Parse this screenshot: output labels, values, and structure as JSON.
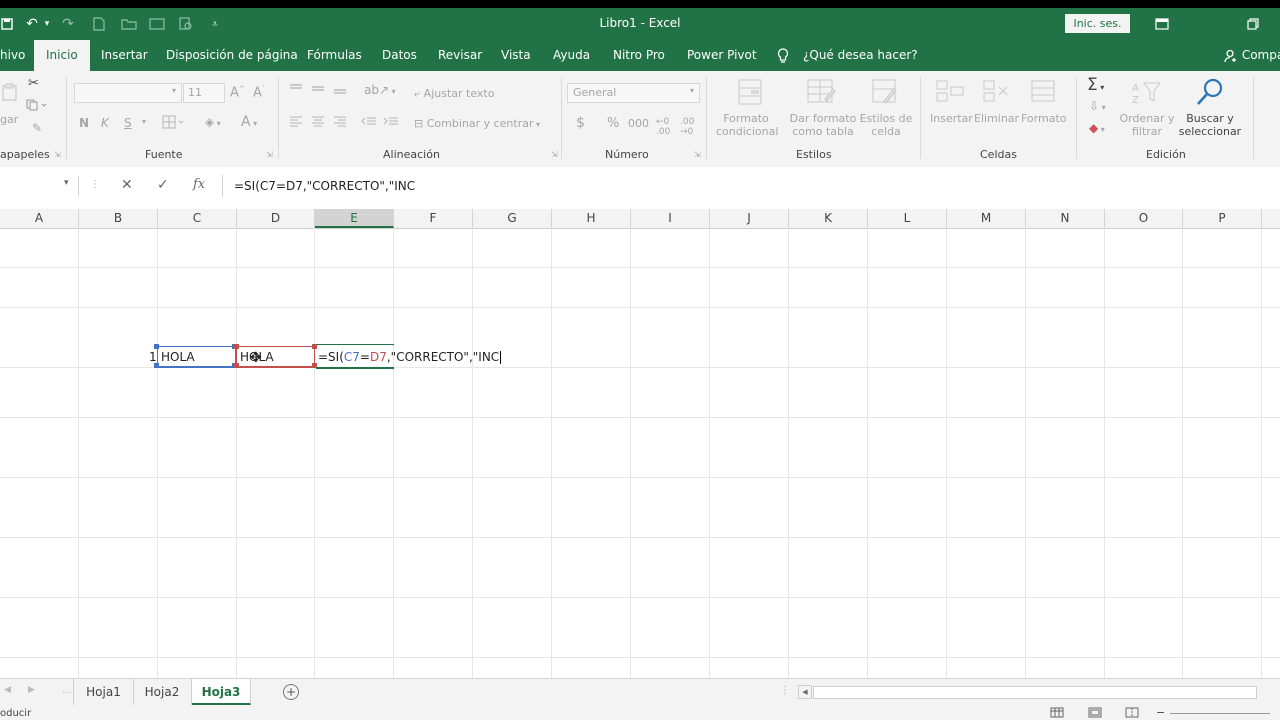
{
  "window": {
    "title": "Libro1  -  Excel",
    "signin_label": "Inic. ses."
  },
  "tabs": [
    {
      "label": "hivo",
      "active": false
    },
    {
      "label": "Inicio",
      "active": true
    },
    {
      "label": "Insertar",
      "active": false
    },
    {
      "label": "Disposición de página",
      "active": false
    },
    {
      "label": "Fórmulas",
      "active": false
    },
    {
      "label": "Datos",
      "active": false
    },
    {
      "label": "Revisar",
      "active": false
    },
    {
      "label": "Vista",
      "active": false
    },
    {
      "label": "Ayuda",
      "active": false
    },
    {
      "label": "Nitro Pro",
      "active": false
    },
    {
      "label": "Power Pivot",
      "active": false
    }
  ],
  "tellme": "¿Qué desea hacer?",
  "share": "Compa",
  "ribbon": {
    "clipboard": {
      "label": "apapeles",
      "paste_label": "gar"
    },
    "font": {
      "label": "Fuente",
      "size": "11",
      "bold": "N",
      "italic": "K",
      "underline": "S"
    },
    "alignment": {
      "label": "Alineación",
      "wrap": "Ajustar texto",
      "merge": "Combinar y centrar"
    },
    "number": {
      "label": "Número",
      "format": "General",
      "percent": "%",
      "thousands": "000",
      "currency": "$"
    },
    "styles": {
      "label": "Estilos",
      "conditional": [
        "Formato",
        "condicional"
      ],
      "as_table": [
        "Dar formato",
        "como tabla"
      ],
      "cell_styles": [
        "Estilos de",
        "celda"
      ]
    },
    "cells": {
      "label": "Celdas",
      "insert": "Insertar",
      "delete": "Eliminar",
      "format": "Formato"
    },
    "editing": {
      "label": "Edición",
      "sort": [
        "Ordenar y",
        "filtrar"
      ],
      "find": [
        "Buscar y",
        "seleccionar"
      ]
    }
  },
  "formula_bar": {
    "value": "=SI(C7=D7,\"CORRECTO\",\"INC",
    "fx": "fx"
  },
  "columns": [
    "A",
    "B",
    "C",
    "D",
    "E",
    "F",
    "G",
    "H",
    "I",
    "J",
    "K",
    "L",
    "M",
    "N",
    "O",
    "P"
  ],
  "selected_column": "E",
  "cells": {
    "b_fragment": "1",
    "c7": "HOLA",
    "d7": "HOLA",
    "e7_prefix": "=SI(",
    "e7_ref1": "C7",
    "e7_eq": "=",
    "e7_ref2": "D7",
    "e7_suffix": ",\"CORRECTO\",\"INC"
  },
  "sheets": [
    {
      "name": "Hoja1",
      "active": false
    },
    {
      "name": "Hoja2",
      "active": false
    },
    {
      "name": "Hoja3",
      "active": true
    }
  ],
  "status": "oducir",
  "colors": {
    "accent": "#217346",
    "ref_blue": "#4472c4",
    "ref_red": "#c0504d"
  }
}
